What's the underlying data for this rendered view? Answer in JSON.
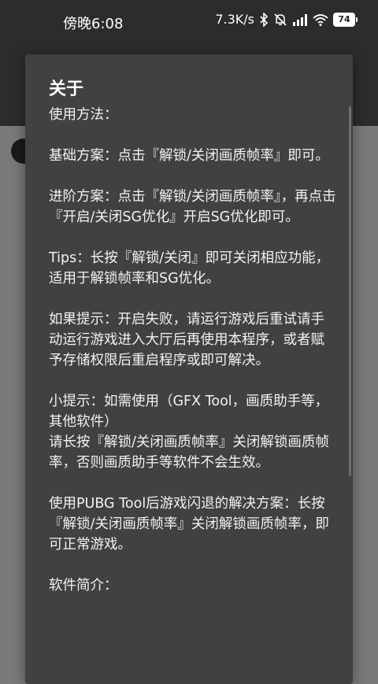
{
  "status_bar": {
    "time": "傍晚6:08",
    "net_speed": "7.3K/s",
    "battery": "74",
    "icons": [
      "bluetooth-icon",
      "mute-icon",
      "signal-icon",
      "wifi-icon",
      "battery-icon"
    ]
  },
  "dialog": {
    "title": "关于",
    "body": "使用方法：\n\n基础方案：点击『解锁/关闭画质帧率』即可。\n\n进阶方案：点击『解锁/关闭画质帧率』，再点击『开启/关闭SG优化』开启SG优化即可。\n\nTips：长按『解锁/关闭』即可关闭相应功能，适用于解锁帧率和SG优化。\n\n如果提示：开启失败，请运行游戏后重试请手动运行游戏进入大厅后再使用本程序，或者赋予存储权限后重启程序或即可解决。\n\n小提示：如需使用（GFX Tool，画质助手等，其他软件）\n请长按『解锁/关闭画质帧率』关闭解锁画质帧率，否则画质助手等软件不会生效。\n\n使用PUBG Tool后游戏闪退的解决方案：长按『解锁/关闭画质帧率』关闭解锁画质帧率，即可正常游戏。\n\n软件简介："
  },
  "colors": {
    "dialog_bg": "#414141",
    "scrim": "#7a7a7a",
    "app_bar": "#2c2c2c"
  }
}
